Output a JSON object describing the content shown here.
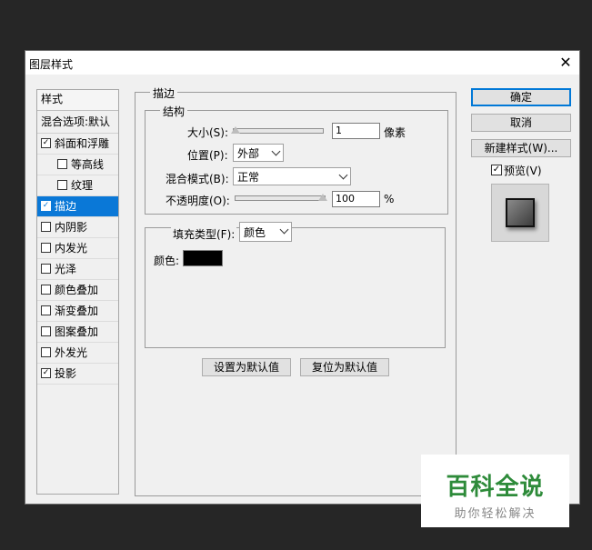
{
  "window": {
    "title": "图层样式",
    "close_glyph": "✕"
  },
  "styles": {
    "header": "样式",
    "blend_options": "混合选项:默认",
    "items": [
      {
        "label": "斜面和浮雕",
        "checked": true,
        "indent": false,
        "selected": false
      },
      {
        "label": "等高线",
        "checked": false,
        "indent": true,
        "selected": false
      },
      {
        "label": "纹理",
        "checked": false,
        "indent": true,
        "selected": false
      },
      {
        "label": "描边",
        "checked": true,
        "indent": false,
        "selected": true
      },
      {
        "label": "内阴影",
        "checked": false,
        "indent": false,
        "selected": false
      },
      {
        "label": "内发光",
        "checked": false,
        "indent": false,
        "selected": false
      },
      {
        "label": "光泽",
        "checked": false,
        "indent": false,
        "selected": false
      },
      {
        "label": "颜色叠加",
        "checked": false,
        "indent": false,
        "selected": false
      },
      {
        "label": "渐变叠加",
        "checked": false,
        "indent": false,
        "selected": false
      },
      {
        "label": "图案叠加",
        "checked": false,
        "indent": false,
        "selected": false
      },
      {
        "label": "外发光",
        "checked": false,
        "indent": false,
        "selected": false
      },
      {
        "label": "投影",
        "checked": true,
        "indent": false,
        "selected": false
      }
    ]
  },
  "stroke": {
    "group_title": "描边",
    "structure_title": "结构",
    "size_label": "大小(S):",
    "size_value": "1",
    "size_unit": "像素",
    "position_label": "位置(P):",
    "position_value": "外部",
    "blend_mode_label": "混合模式(B):",
    "blend_mode_value": "正常",
    "opacity_label": "不透明度(O):",
    "opacity_value": "100",
    "opacity_unit": "%",
    "fill_type_label": "填充类型(F):",
    "fill_type_value": "颜色",
    "color_label": "颜色:",
    "color_value": "#000000",
    "make_default_label": "设置为默认值",
    "reset_default_label": "复位为默认值"
  },
  "actions": {
    "ok_label": "确定",
    "cancel_label": "取消",
    "new_style_label": "新建样式(W)...",
    "preview_label": "预览(V)",
    "preview_checked": true
  },
  "watermark": {
    "main": "百科全说",
    "sub": "助你轻松解决"
  },
  "colors": {
    "selection": "#0a78d7",
    "background": "#262626",
    "accent": "#0078d7"
  }
}
